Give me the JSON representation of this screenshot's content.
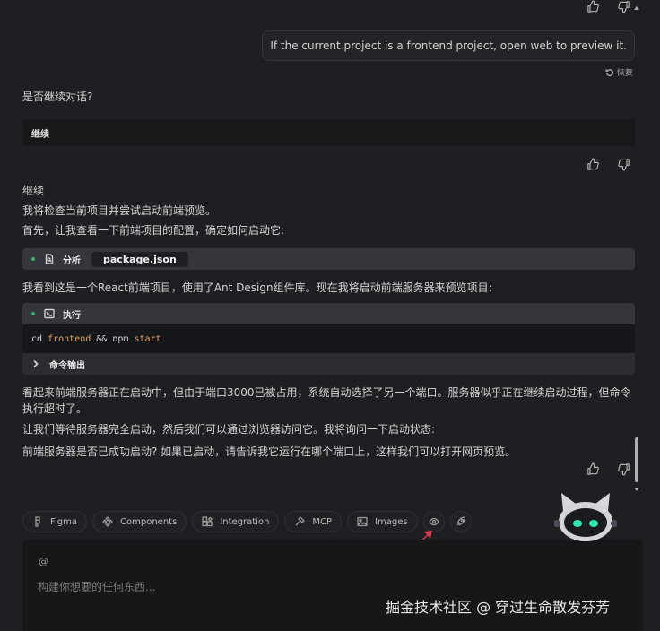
{
  "conversation": {
    "user_message": "If the current project is a frontend project, open web to preview it.",
    "restore_label": "恢复",
    "question": "是否继续对话?",
    "option_continue": "继续",
    "reply": {
      "line1": "继续",
      "line2": "我将检查当前项目并尝试启动前端预览。",
      "line3": "首先，让我查看一下前端项目的配置，确定如何启动它:",
      "analyze_tool": {
        "label": "分析",
        "file": "package.json"
      },
      "line4": "我看到这是一个React前端项目，使用了Ant Design组件库。现在我将启动前端服务器来预览项目:",
      "exec_tool": {
        "label": "执行",
        "code": {
          "cmd1": "cd",
          "arg1": "frontend",
          "op": "&&",
          "cmd2": "npm",
          "arg2": "start"
        },
        "output_label": "命令输出"
      },
      "line5": "看起来前端服务器正在启动中，但由于端口3000已被占用，系统自动选择了另一个端口。服务器似乎正在继续启动过程，但命令执行超时了。",
      "line6": "让我们等待服务器完全启动，然后我们可以通过浏览器访问它。我将询问一下启动状态:",
      "line7": "前端服务器是否已成功启动? 如果已启动，请告诉我它运行在哪个端口上，这样我们可以打开网页预览。"
    }
  },
  "toolbar": {
    "chips": [
      {
        "label": "Figma",
        "icon": "figma-icon"
      },
      {
        "label": "Components",
        "icon": "components-icon"
      },
      {
        "label": "Integration",
        "icon": "integration-icon"
      },
      {
        "label": "MCP",
        "icon": "mcp-icon"
      },
      {
        "label": "Images",
        "icon": "image-icon"
      }
    ],
    "preview_icon": "eye-icon",
    "deploy_icon": "rocket-icon"
  },
  "input": {
    "at_symbol": "@",
    "placeholder": "构建你想要的任何东西..."
  },
  "watermark": "掘金技术社区 @ 穿过生命散发芬芳",
  "colors": {
    "background": "#1e1f22",
    "status_dot": "#3fae6a",
    "code_path": "#e0a56a",
    "pointer_arrow": "#e0394a",
    "mascot_eyes": "#2fe6b0"
  }
}
